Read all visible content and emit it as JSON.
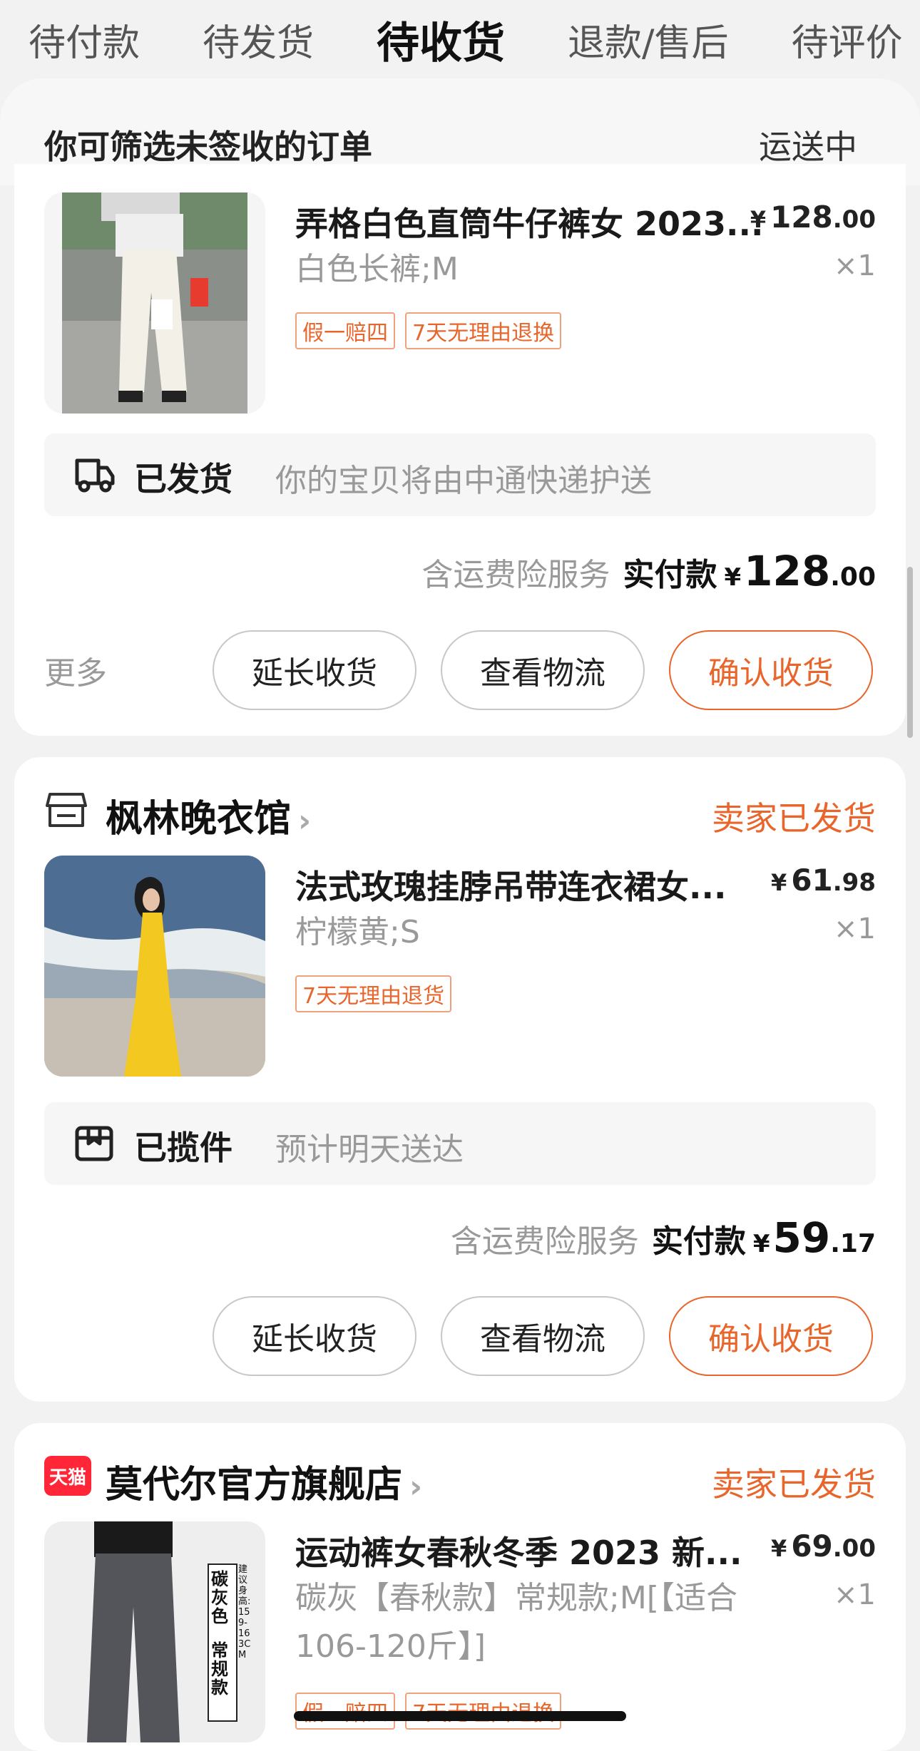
{
  "tabs": [
    "待付款",
    "待发货",
    "待收货",
    "退款/售后",
    "待评价"
  ],
  "active_tab_index": 2,
  "filter": {
    "text": "你可筛选未签收的订单",
    "right": "运送中"
  },
  "orders": [
    {
      "product": {
        "title": "弄格白色直筒牛仔裤女 2023...",
        "price_int": "128",
        "price_dec": ".00",
        "currency": "¥",
        "sku": "白色长裤;M",
        "qty": "×1",
        "tags": [
          "假一赔四",
          "7天无理由退换"
        ]
      },
      "logistics": {
        "status": "已发货",
        "text": "你的宝贝将由中通快递护送"
      },
      "payment": {
        "insurance": "含运费险服务",
        "label": "实付款",
        "currency": "¥",
        "int": "128",
        "dec": ".00"
      },
      "more": "更多",
      "buttons": [
        "延长收货",
        "查看物流",
        "确认收货"
      ]
    },
    {
      "shop": {
        "name": "枫林晚衣馆",
        "status": "卖家已发货"
      },
      "product": {
        "title": "法式玫瑰挂脖吊带连衣裙女...",
        "price_int": "61",
        "price_dec": ".98",
        "currency": "¥",
        "sku": "柠檬黄;S",
        "qty": "×1",
        "tags": [
          "7天无理由退货"
        ]
      },
      "logistics": {
        "status": "已揽件",
        "text": "预计明天送达"
      },
      "payment": {
        "insurance": "含运费险服务",
        "label": "实付款",
        "currency": "¥",
        "int": "59",
        "dec": ".17"
      },
      "buttons": [
        "延长收货",
        "查看物流",
        "确认收货"
      ]
    },
    {
      "shop": {
        "badge": "天猫",
        "name": "莫代尔官方旗舰店",
        "status": "卖家已发货"
      },
      "product": {
        "title": "运动裤女春秋冬季 2023 新...",
        "price_int": "69",
        "price_dec": ".00",
        "currency": "¥",
        "sku": "碳灰【春秋款】常规款;M[【适合106-120斤】]",
        "qty": "×1",
        "tags": [
          "假一赔四",
          "7天无理由退换"
        ],
        "image_label": {
          "color": "碳灰色",
          "style": "常规款",
          "note": "建议身高:159-163CM"
        }
      }
    }
  ],
  "colors": {
    "accent": "#e8662c",
    "tmall": "#ff2638"
  }
}
